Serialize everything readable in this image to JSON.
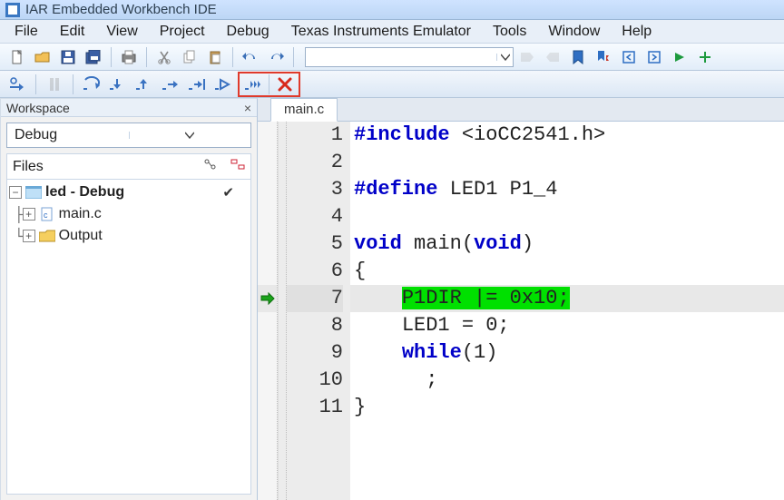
{
  "app": {
    "title": "IAR Embedded Workbench IDE"
  },
  "menu": {
    "items": [
      "File",
      "Edit",
      "View",
      "Project",
      "Debug",
      "Texas Instruments Emulator",
      "Tools",
      "Window",
      "Help"
    ]
  },
  "toolbar": {
    "combo_text": ""
  },
  "workspace": {
    "title": "Workspace",
    "config": "Debug",
    "files_label": "Files",
    "tree": {
      "project": "led - Debug",
      "items": [
        "main.c",
        "Output"
      ]
    }
  },
  "editor": {
    "tab": "main.c",
    "lines": [
      {
        "n": 1,
        "kind": "code",
        "segs": [
          [
            "pre",
            "#include"
          ],
          [
            "txt",
            " <ioCC2541.h>"
          ]
        ]
      },
      {
        "n": 2,
        "kind": "blank"
      },
      {
        "n": 3,
        "kind": "code",
        "segs": [
          [
            "pre",
            "#define"
          ],
          [
            "txt",
            " LED1 P1_4"
          ]
        ]
      },
      {
        "n": 4,
        "kind": "blank"
      },
      {
        "n": 5,
        "kind": "code",
        "segs": [
          [
            "kw",
            "void"
          ],
          [
            "txt",
            " main("
          ],
          [
            "kw",
            "void"
          ],
          [
            "txt",
            ")"
          ]
        ]
      },
      {
        "n": 6,
        "kind": "code",
        "segs": [
          [
            "txt",
            "{"
          ]
        ]
      },
      {
        "n": 7,
        "kind": "exec",
        "indent": "    ",
        "hl": "P1DIR |= 0x10;"
      },
      {
        "n": 8,
        "kind": "code",
        "indent": "    ",
        "segs": [
          [
            "txt",
            "LED1 = 0;"
          ]
        ]
      },
      {
        "n": 9,
        "kind": "code",
        "indent": "    ",
        "segs": [
          [
            "kw",
            "while"
          ],
          [
            "txt",
            "(1)"
          ]
        ]
      },
      {
        "n": 10,
        "kind": "code",
        "indent": "      ",
        "segs": [
          [
            "txt",
            ";"
          ]
        ]
      },
      {
        "n": 11,
        "kind": "code",
        "segs": [
          [
            "txt",
            "}"
          ]
        ]
      }
    ]
  }
}
